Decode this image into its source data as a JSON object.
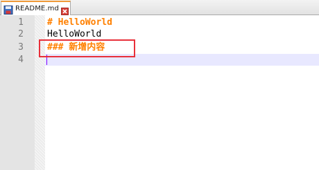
{
  "tab": {
    "filename": "README.md",
    "icon": "save-disk-icon",
    "close_icon": "close-icon"
  },
  "lines": [
    {
      "number": "1",
      "text": "# HelloWorld"
    },
    {
      "number": "2",
      "text": "HelloWorld"
    },
    {
      "number": "3",
      "text": "### 新增内容"
    },
    {
      "number": "4",
      "text": ""
    }
  ],
  "colors": {
    "heading": "#ff8000",
    "current_line": "#e8e8ff",
    "annotation_box": "#e8303a",
    "tab_accent": "#f09a38"
  }
}
